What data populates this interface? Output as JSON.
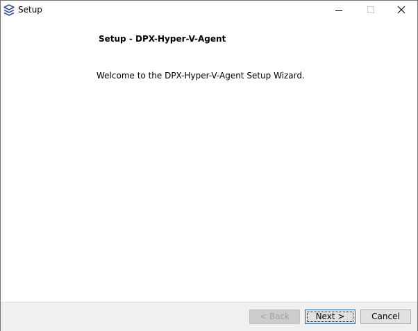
{
  "window": {
    "title": "Setup",
    "app_icon": "stacked-layers-icon"
  },
  "content": {
    "heading": "Setup - DPX-Hyper-V-Agent",
    "welcome": "Welcome to the DPX-Hyper-V-Agent Setup Wizard."
  },
  "buttons": {
    "back": "< Back",
    "next": "Next >",
    "cancel": "Cancel"
  },
  "colors": {
    "icon_blue": "#3a4a9c",
    "focus_border": "#0078d7",
    "footer_bg": "#f0f0f0"
  }
}
